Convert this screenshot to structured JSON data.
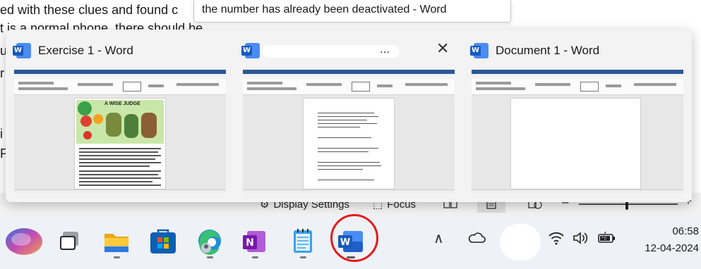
{
  "background_doc": {
    "lines": [
      "ed with these clues and found c",
      "t is a normal phone, there should be",
      "u",
      "r",
      "i",
      "P"
    ],
    "status": {
      "display_settings": "Display Settings",
      "focus": "Focus",
      "zoom_minus": "–",
      "zoom_plus": "+"
    }
  },
  "tooltip": {
    "text": "the number has already been deactivated - Word"
  },
  "flyout": {
    "thumbnails": [
      {
        "title": "Exercise 1 - Word",
        "icon": "word-icon",
        "page_heading": "A WISE JUDGE"
      },
      {
        "title": "...",
        "icon": "word-icon",
        "close": "✕"
      },
      {
        "title": "Document 1 - Word",
        "icon": "word-icon"
      }
    ]
  },
  "taskbar": {
    "apps": [
      {
        "name": "copilot",
        "icon": "copilot-icon"
      },
      {
        "name": "task-view",
        "icon": "task-view-icon"
      },
      {
        "name": "file-explorer",
        "icon": "folder-icon"
      },
      {
        "name": "microsoft-store",
        "icon": "store-icon"
      },
      {
        "name": "edge",
        "icon": "edge-icon"
      },
      {
        "name": "onenote",
        "icon": "onenote-icon",
        "letter": "N"
      },
      {
        "name": "notepad",
        "icon": "notepad-icon"
      },
      {
        "name": "word",
        "icon": "word-icon",
        "letter": "W"
      }
    ],
    "tray": {
      "chevron": "∧",
      "clock_time": "06:58",
      "clock_date": "12-04-2024"
    }
  },
  "colors": {
    "accent_red": "#e41b1b",
    "word_blue": "#185abd",
    "taskbar_bg": "#eef1f6"
  }
}
